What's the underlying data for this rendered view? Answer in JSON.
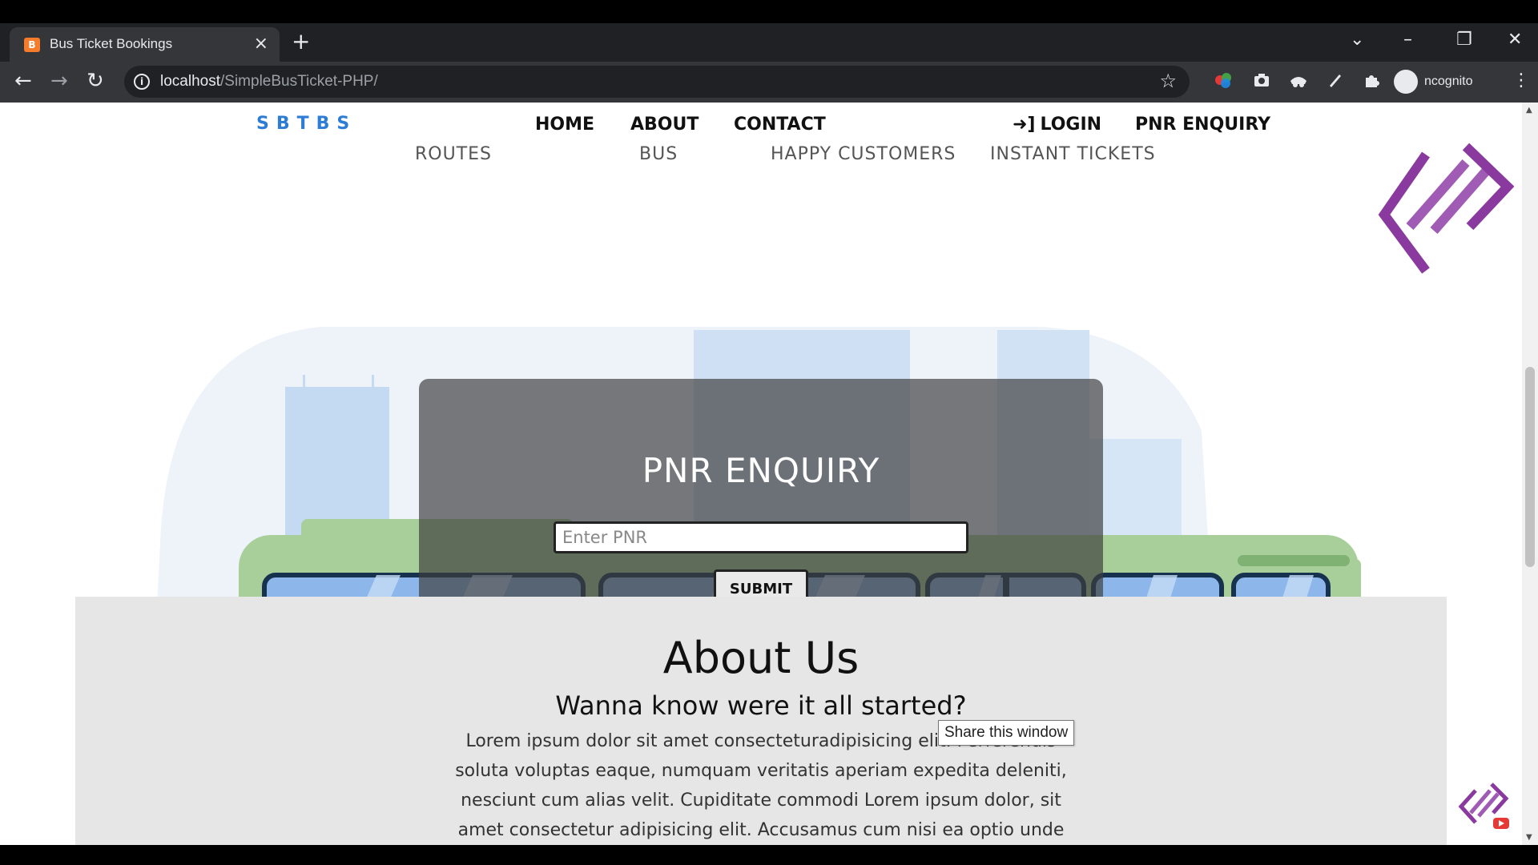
{
  "browser": {
    "tab_title": "Bus Ticket Bookings",
    "tab_favicon_letter": "B",
    "tab_close": "×",
    "new_tab": "+",
    "url_host": "localhost",
    "url_path": "/SimpleBusTicket-PHP/",
    "profile_label": "ncognito",
    "window_controls": {
      "list": "⌄",
      "minimize": "–",
      "restore": "❐",
      "close": "✕"
    },
    "nav": {
      "back": "←",
      "forward": "→",
      "reload": "↻",
      "star": "☆"
    },
    "extensions": [
      "color-icon",
      "camera-icon",
      "incognito-mask-icon",
      "pen-icon",
      "puzzle-icon"
    ]
  },
  "site": {
    "brand": "SBTBS",
    "nav": {
      "home": "HOME",
      "about": "ABOUT",
      "contact": "CONTACT",
      "login": "LOGIN",
      "pnr_enquiry": "PNR ENQUIRY"
    },
    "stats": {
      "routes": "ROUTES",
      "bus": "BUS",
      "happy_customers": "HAPPY CUSTOMERS",
      "instant_tickets": "INSTANT TICKETS"
    },
    "pnr": {
      "title": "PNR ENQUIRY",
      "input_placeholder": "Enter PNR",
      "submit_label": "SUBMIT"
    },
    "about": {
      "title": "About Us",
      "subtitle": "Wanna know were it all started?",
      "body": "Lorem ipsum dolor sit amet consecteturadipisicing elit. Perferendis soluta voluptas eaque, numquam veritatis aperiam expedita deleniti, nesciunt cum alias velit. Cupiditate commodi Lorem ipsum dolor, sit amet consectetur adipisicing elit. Accusamus cum nisi ea optio unde"
    },
    "tooltip": "Share this window"
  },
  "colors": {
    "brand": "#2d7cd6",
    "overlay": "#3c3c3c",
    "about_bg": "#e6e6e6",
    "bus_green": "#a8cf9a",
    "window_blue": "#8db6ea",
    "watermark": "#8a3a9e"
  }
}
